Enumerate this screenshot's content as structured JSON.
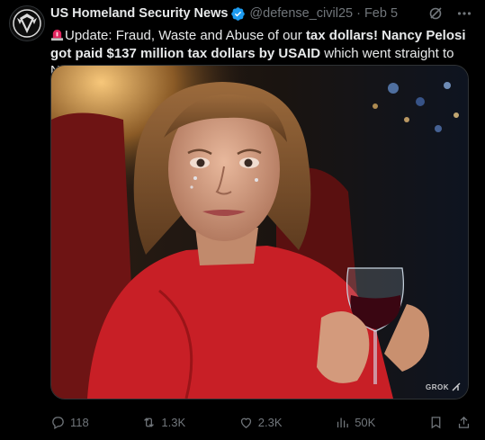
{
  "author": {
    "name": "US Homeland Security News",
    "handle": "@defense_civil25",
    "date": "Feb 5"
  },
  "post_text": {
    "siren_emoji": "siren-icon",
    "segments": [
      {
        "text": "Update: Fraud, Waste and Abuse of our ",
        "bold": false
      },
      {
        "text": "tax dollars! Nancy Pelosi got paid $137 million tax dollars by USAID",
        "bold": true
      },
      {
        "text": " which went straight to Nvidia calls.",
        "bold": false
      }
    ]
  },
  "media": {
    "watermark": "GROK"
  },
  "actions": {
    "replies": "118",
    "reposts": "1.3K",
    "likes": "2.3K",
    "views": "50K"
  },
  "colors": {
    "background": "#000000",
    "text": "#e7e9ea",
    "muted": "#71767b",
    "verified": "#1d9bf0"
  }
}
